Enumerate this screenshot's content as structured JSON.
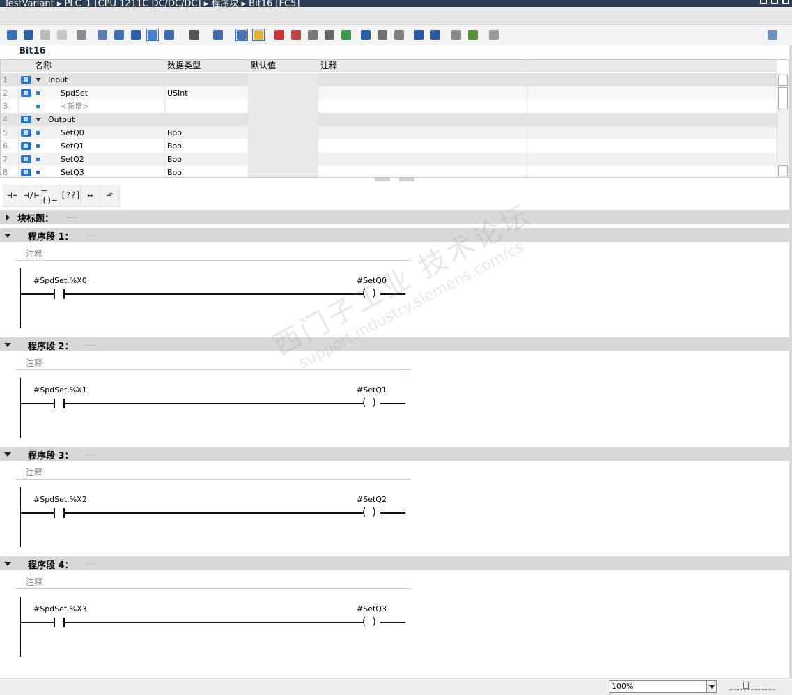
{
  "titlebar": {
    "text": "TestVariant  ▸  PLC_1 [CPU 1211C DC/DC/DC]  ▸  程序块  ▸  Bit16 [FC5]"
  },
  "block": {
    "name": "Bit16"
  },
  "interface": {
    "headers": {
      "name": "名称",
      "type": "数据类型",
      "default": "默认值",
      "comment": "注释"
    },
    "rows": [
      {
        "num": "1",
        "name": "Input",
        "type": "",
        "kind": "group"
      },
      {
        "num": "2",
        "name": "SpdSet",
        "type": "USInt",
        "kind": "var"
      },
      {
        "num": "3",
        "name": "<新增>",
        "type": "",
        "kind": "add"
      },
      {
        "num": "4",
        "name": "Output",
        "type": "",
        "kind": "group"
      },
      {
        "num": "5",
        "name": "SetQ0",
        "type": "Bool",
        "kind": "var"
      },
      {
        "num": "6",
        "name": "SetQ1",
        "type": "Bool",
        "kind": "var"
      },
      {
        "num": "7",
        "name": "SetQ2",
        "type": "Bool",
        "kind": "var"
      },
      {
        "num": "8",
        "name": "SetQ3",
        "type": "Bool",
        "kind": "var"
      }
    ]
  },
  "palette": {
    "items": [
      {
        "name": "no-contact",
        "glyph": "⊣⊢"
      },
      {
        "name": "nc-contact",
        "glyph": "⊣/⊢"
      },
      {
        "name": "coil",
        "glyph": "–()–"
      },
      {
        "name": "empty-box",
        "glyph": "[??]"
      },
      {
        "name": "open-branch",
        "glyph": "↦"
      },
      {
        "name": "close-branch",
        "glyph": "⬏"
      }
    ]
  },
  "block_title": {
    "label": "块标题：",
    "dots": "....."
  },
  "networks": [
    {
      "label": "程序段 1：",
      "dots": ".....",
      "comment": "注释",
      "contact": "#SpdSet.%X0",
      "coil": "#SetQ0"
    },
    {
      "label": "程序段 2：",
      "dots": ".....",
      "comment": "注释",
      "contact": "#SpdSet.%X1",
      "coil": "#SetQ1"
    },
    {
      "label": "程序段 3：",
      "dots": ".....",
      "comment": "注释",
      "contact": "#SpdSet.%X2",
      "coil": "#SetQ2"
    },
    {
      "label": "程序段 4：",
      "dots": ".....",
      "comment": "注释",
      "contact": "#SpdSet.%X3",
      "coil": "#SetQ3"
    }
  ],
  "watermark": {
    "cn": "西门子工业  技术论坛",
    "en": "support.industry.siemens.com/cs"
  },
  "status": {
    "zoom": "100%"
  }
}
